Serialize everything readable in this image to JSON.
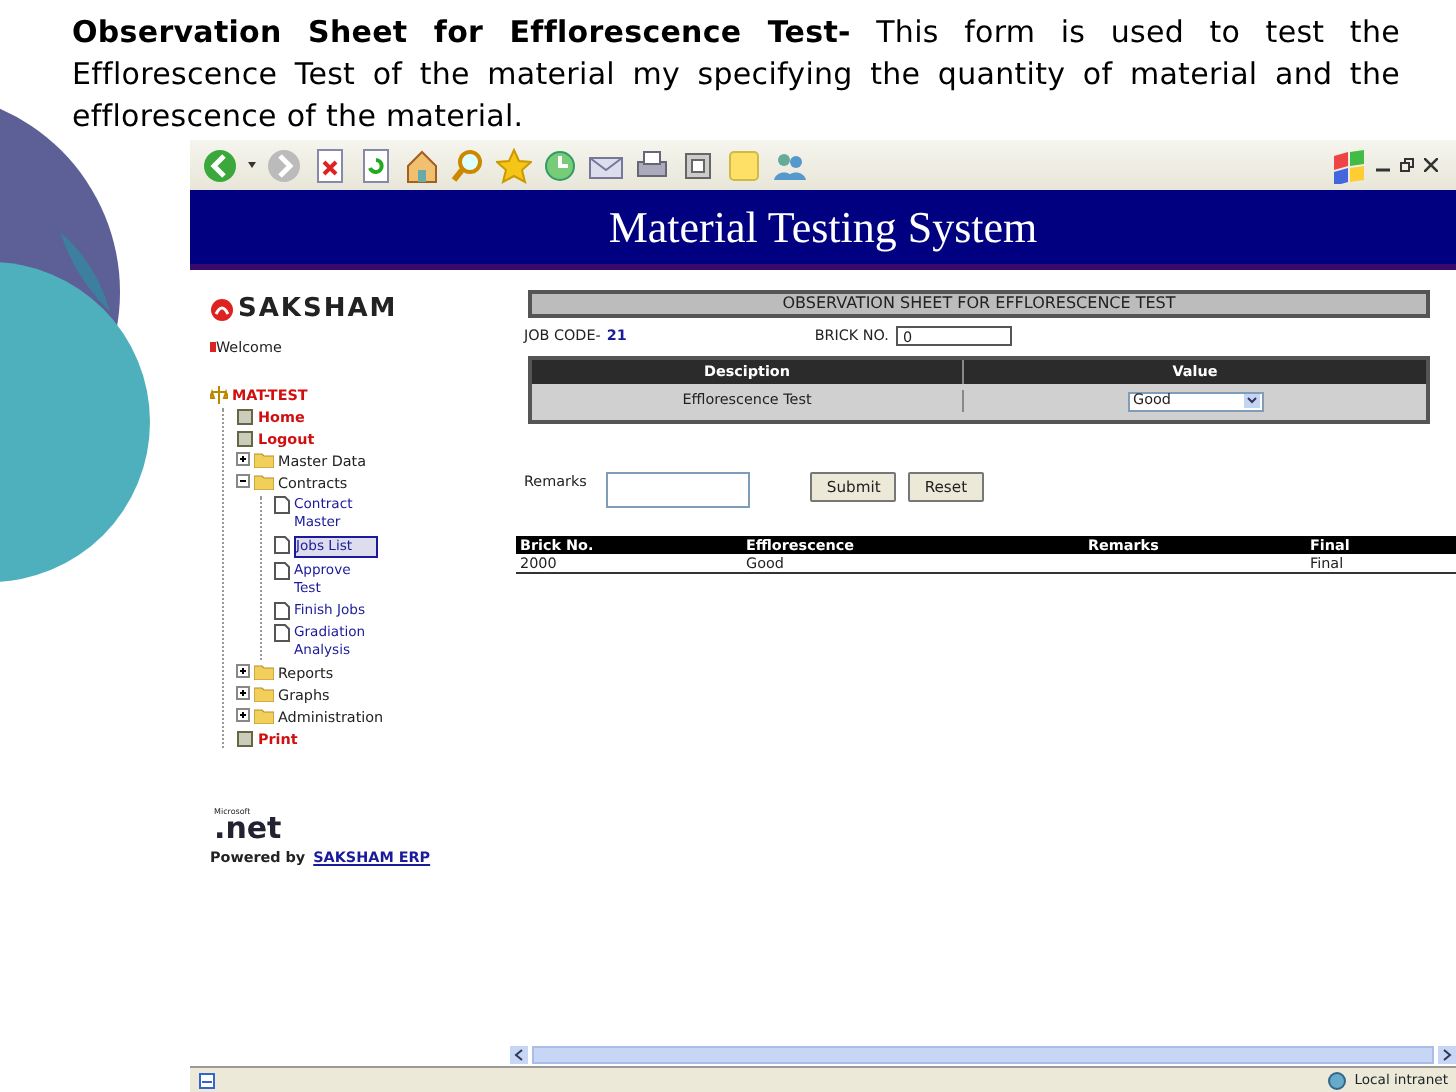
{
  "slide_text": "**Observation Sheet for Efflorescence Test-** This form is used to test the Efflorescence Test of the material my specifying the quantity of material and the efflorescence of the material.",
  "browser": {
    "banner_title": "Material Testing System",
    "sidebar": {
      "logo": "SAKSHAM",
      "welcome": "Welcome",
      "tree": {
        "label": "MAT-TEST",
        "children": [
          {
            "label": "Home",
            "kind": "page"
          },
          {
            "label": "Logout",
            "kind": "page"
          },
          {
            "label": "Master Data",
            "kind": "folder",
            "expanded": false
          },
          {
            "label": "Contracts",
            "kind": "folder",
            "expanded": true,
            "children": [
              {
                "label": "Contract Master",
                "kind": "doc",
                "selected": false
              },
              {
                "label": "Jobs List",
                "kind": "doc",
                "selected": true
              },
              {
                "label": "Approve Test",
                "kind": "doc",
                "selected": false
              },
              {
                "label": "Finish Jobs",
                "kind": "doc",
                "selected": false
              },
              {
                "label": "Gradiation Analysis",
                "kind": "doc",
                "selected": false
              }
            ]
          },
          {
            "label": "Reports",
            "kind": "folder",
            "expanded": false
          },
          {
            "label": "Graphs",
            "kind": "folder",
            "expanded": false
          },
          {
            "label": "Administration",
            "kind": "folder",
            "expanded": false
          },
          {
            "label": "Print",
            "kind": "page"
          }
        ]
      },
      "net_logo": ".net",
      "net_maker": "Microsoft",
      "powered_by": "Powered by",
      "powered_link": "SAKSHAM ERP"
    },
    "form": {
      "title": "OBSERVATION SHEET FOR EFFLORESCENCE TEST",
      "job_code_label": "JOB CODE-",
      "job_code": "21",
      "brick_no_label": "BRICK NO.",
      "brick_no": "0",
      "columns": [
        "Desciption",
        "Value"
      ],
      "rows": [
        {
          "description": "Efflorescence Test",
          "value": "Good"
        }
      ],
      "remarks_label": "Remarks",
      "buttons": [
        "Submit",
        "Reset"
      ],
      "results": {
        "columns": [
          "Brick No.",
          "Efflorescence",
          "Remarks",
          "Final"
        ],
        "rows": [
          [
            "2000",
            "Good",
            "",
            "Final"
          ]
        ]
      }
    },
    "status_bar": {
      "zone": "Local intranet"
    }
  }
}
